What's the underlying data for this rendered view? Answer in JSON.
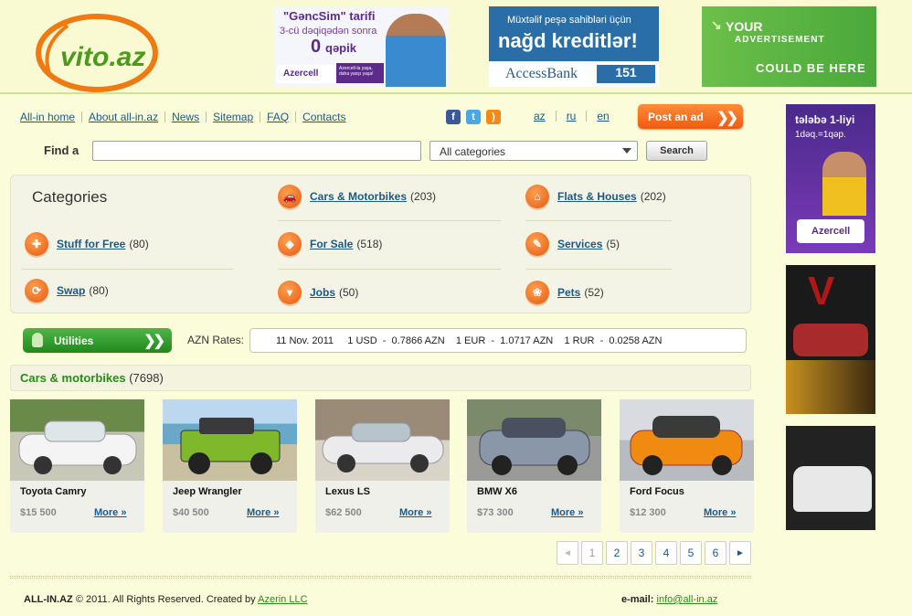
{
  "logo": {
    "text": "vito.az"
  },
  "banners": {
    "gencsim": {
      "title": "\"GəncSim\" tarifi",
      "line2": "3-cü dəqiqədən sonra",
      "amount": "0",
      "unit": "qəpik",
      "brand": "Azercell",
      "tag": "Azercell-la yaşa, daha yaxşı yaşa!"
    },
    "access": {
      "line1": "Müxtəlif peşə sahibləri üçün",
      "line2": "nağd kreditlər!",
      "brand": "AccessBank",
      "num": "151"
    },
    "your_ad": {
      "line1": "YOUR",
      "line2": "ADVERTISEMENT",
      "line3": "COULD BE HERE"
    },
    "side1": {
      "line1": "tələbə 1-liyi",
      "line2": "1dəq.=1qəp.",
      "brand": "Azercell"
    }
  },
  "nav": [
    "All-in home",
    "About all-in.az",
    "News",
    "Sitemap",
    "FAQ",
    "Contacts"
  ],
  "langs": [
    "az",
    "ru",
    "en"
  ],
  "post_ad": "Post an ad",
  "search": {
    "label": "Find a",
    "value": "",
    "category": "All categories",
    "button": "Search"
  },
  "categories": {
    "title": "Categories",
    "items": [
      {
        "label": "Cars & Motorbikes",
        "count": "(203)",
        "icon": "car-icon"
      },
      {
        "label": "Flats & Houses",
        "count": "(202)",
        "icon": "house-icon"
      },
      {
        "label": "Stuff for Free",
        "count": "(80)",
        "icon": "gift-icon"
      },
      {
        "label": "For Sale",
        "count": "(518)",
        "icon": "tag-icon"
      },
      {
        "label": "Services",
        "count": "(5)",
        "icon": "wrench-icon"
      },
      {
        "label": "Swap",
        "count": "(80)",
        "icon": "swap-icon"
      },
      {
        "label": "Jobs",
        "count": "(50)",
        "icon": "tie-icon"
      },
      {
        "label": "Pets",
        "count": "(52)",
        "icon": "paw-icon"
      }
    ]
  },
  "utilities": "Utilities",
  "rates": {
    "label": "AZN Rates:",
    "text": "11 Nov. 2011     1 USD  -  0.7866 AZN    1 EUR  -  1.0717 AZN    1 RUR  -  0.0258 AZN"
  },
  "section": {
    "title": "Cars & motorbikes",
    "count": "(7698)"
  },
  "cars": [
    {
      "name": "Toyota Camry",
      "price": "$15 500",
      "more": "More »",
      "color": "#f2f2f2"
    },
    {
      "name": "Jeep Wrangler",
      "price": "$40 500",
      "more": "More »",
      "color": "#7fb82a"
    },
    {
      "name": "Lexus LS",
      "price": "$62 500",
      "more": "More »",
      "color": "#e8e8ea"
    },
    {
      "name": "BMW X6",
      "price": "$73 300",
      "more": "More »",
      "color": "#8a97a8"
    },
    {
      "name": "Ford Focus",
      "price": "$12 300",
      "more": "More »",
      "color": "#f08a10"
    }
  ],
  "pager": [
    "◄",
    "1",
    "2",
    "3",
    "4",
    "5",
    "6",
    "►"
  ],
  "footer": {
    "brand": "ALL-IN.AZ",
    "copy": "© 2011. All Rights Reserved. Created by",
    "company": "Azerin LLC",
    "email_label": "e-mail:",
    "email": "info@all-in.az"
  }
}
